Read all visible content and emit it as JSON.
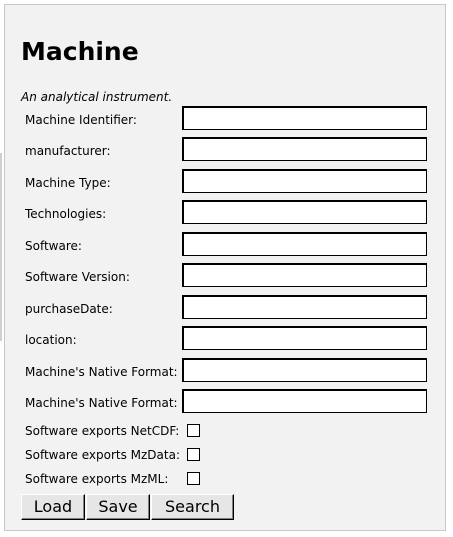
{
  "page": {
    "title": "Machine",
    "subtitle": "An analytical instrument."
  },
  "fields": [
    {
      "label": "Machine Identifier:",
      "value": ""
    },
    {
      "label": "manufacturer:",
      "value": ""
    },
    {
      "label": "Machine Type:",
      "value": ""
    },
    {
      "label": "Technologies:",
      "value": ""
    },
    {
      "label": "Software:",
      "value": ""
    },
    {
      "label": "Software Version:",
      "value": ""
    },
    {
      "label": "purchaseDate:",
      "value": ""
    },
    {
      "label": "location:",
      "value": ""
    },
    {
      "label": "Machine's Native Format:",
      "value": ""
    },
    {
      "label": "Machine's Native Format:",
      "value": ""
    }
  ],
  "checkboxes": [
    {
      "label": "Software exports NetCDF:",
      "checked": false
    },
    {
      "label": "Software exports MzData:",
      "checked": false
    },
    {
      "label": "Software exports MzML:",
      "checked": false
    }
  ],
  "buttons": {
    "load": "Load",
    "save": "Save",
    "search": "Search"
  }
}
